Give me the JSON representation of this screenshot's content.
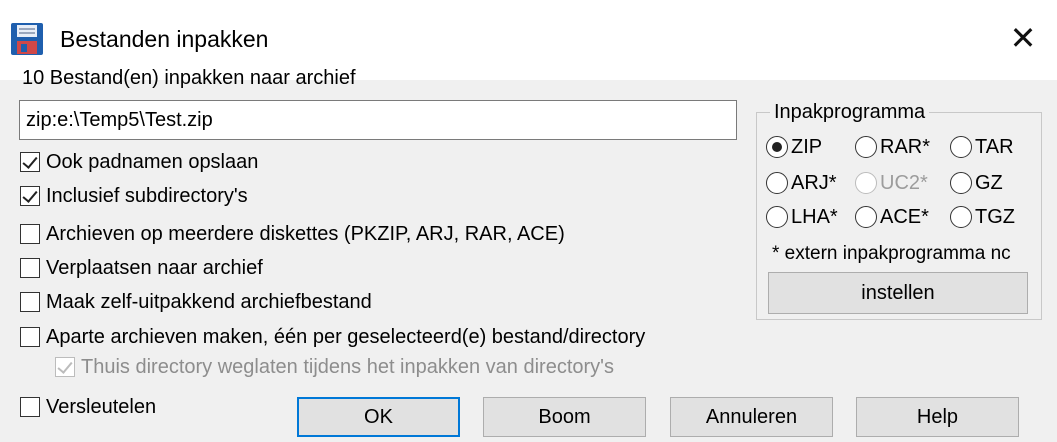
{
  "window": {
    "title": "Bestanden inpakken",
    "close_glyph": "✕"
  },
  "header_text": "10 Bestand(en) inpakken naar archief",
  "archive_path": "zip:e:\\Temp5\\Test.zip",
  "options": [
    {
      "label": "Ook padnamen opslaan",
      "checked": true,
      "enabled": true
    },
    {
      "label": "Inclusief subdirectory's",
      "checked": true,
      "enabled": true
    },
    {
      "label": "Archieven op meerdere diskettes (PKZIP, ARJ, RAR, ACE)",
      "checked": false,
      "enabled": true
    },
    {
      "label": "Verplaatsen naar archief",
      "checked": false,
      "enabled": true
    },
    {
      "label": "Maak zelf-uitpakkend archiefbestand",
      "checked": false,
      "enabled": true
    },
    {
      "label": "Aparte archieven maken, één per geselecteerd(e) bestand/directory",
      "checked": false,
      "enabled": true
    },
    {
      "label": "Thuis directory weglaten tijdens het inpakken van directory's",
      "checked": true,
      "enabled": false
    },
    {
      "label": "Versleutelen",
      "checked": false,
      "enabled": true
    }
  ],
  "packer": {
    "title": "Inpakprogramma",
    "options": [
      {
        "label": "ZIP",
        "checked": true,
        "enabled": true
      },
      {
        "label": "RAR*",
        "checked": false,
        "enabled": true
      },
      {
        "label": "TAR",
        "checked": false,
        "enabled": true
      },
      {
        "label": "ARJ*",
        "checked": false,
        "enabled": true
      },
      {
        "label": "UC2*",
        "checked": false,
        "enabled": false
      },
      {
        "label": "GZ",
        "checked": false,
        "enabled": true
      },
      {
        "label": "LHA*",
        "checked": false,
        "enabled": true
      },
      {
        "label": "ACE*",
        "checked": false,
        "enabled": true
      },
      {
        "label": "TGZ",
        "checked": false,
        "enabled": true
      }
    ],
    "note": "* extern inpakprogramma nc",
    "configure_label": "instellen"
  },
  "buttons": {
    "ok": "OK",
    "tree": "Boom",
    "cancel": "Annuleren",
    "help": "Help"
  },
  "icons": {
    "app": "floppy-disk-icon",
    "close": "close-icon"
  },
  "colors": {
    "accent": "#0078d7",
    "titlebar": "#ffffff",
    "dialog": "#f0f0f0"
  }
}
